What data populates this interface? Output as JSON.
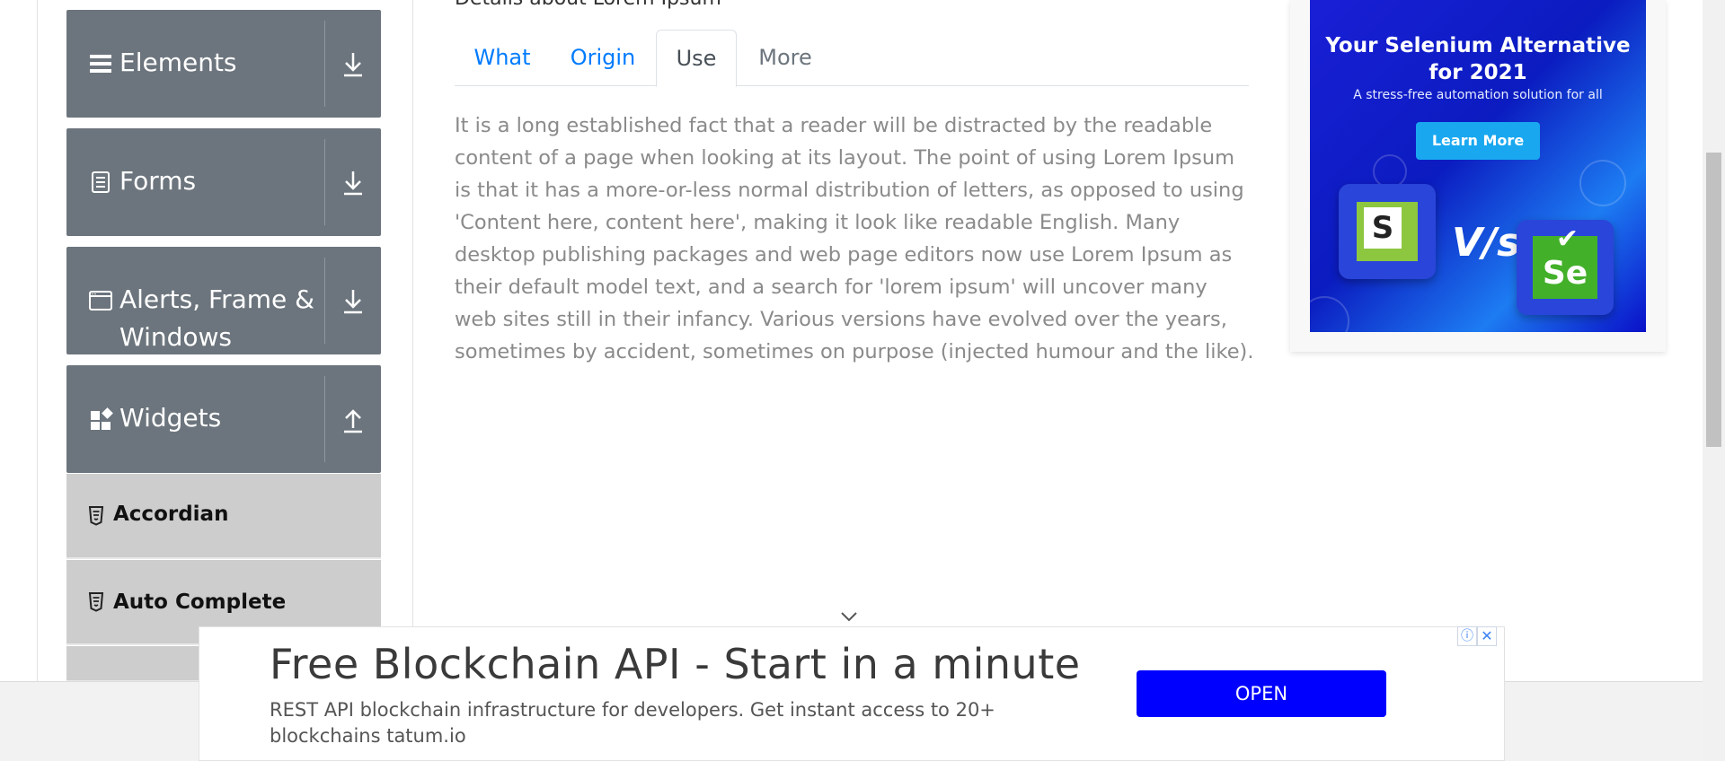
{
  "sidebar": {
    "groups": [
      {
        "label": "Elements",
        "icon": "hamburger-icon",
        "arrow": "download-arrow-icon"
      },
      {
        "label": "Forms",
        "icon": "document-icon",
        "arrow": "download-arrow-icon"
      },
      {
        "label_line1": "Alerts, Frame &",
        "label_line2": "Windows",
        "icon": "window-icon",
        "arrow": "download-arrow-icon"
      },
      {
        "label": "Widgets",
        "icon": "widgets-icon",
        "arrow": "upload-arrow-icon"
      }
    ],
    "items": [
      {
        "label": "Accordian",
        "icon": "html5-icon"
      },
      {
        "label": "Auto Complete",
        "icon": "html5-icon"
      }
    ]
  },
  "main": {
    "caption": "Details about Lorem Ipsum",
    "tabs": [
      {
        "label": "What",
        "state": "link"
      },
      {
        "label": "Origin",
        "state": "link"
      },
      {
        "label": "Use",
        "state": "active"
      },
      {
        "label": "More",
        "state": "disabled"
      }
    ],
    "content": "It is a long established fact that a reader will be distracted by the readable content of a page when looking at its layout. The point of using Lorem Ipsum is that it has a more-or-less normal distribution of letters, as opposed to using 'Content here, content here', making it look like readable English. Many desktop publishing packages and web page editors now use Lorem Ipsum as their default model text, and a search for 'lorem ipsum' will uncover many web sites still in their infancy. Various versions have evolved over the years, sometimes by accident, sometimes on purpose (injected humour and the like)."
  },
  "ad_right": {
    "title_line1": "Your Selenium Alternative",
    "title_line2": "for 2021",
    "subtitle": "A stress-free automation solution for all",
    "button": "Learn More",
    "logo_left_letter": "S",
    "vs_text": "V/s",
    "logo_right_text": "Se"
  },
  "ad_bottom": {
    "headline": "Free Blockchain API - Start in a minute",
    "description": "REST API blockchain infrastructure for developers. Get instant access to 20+ blockchains tatum.io",
    "button": "OPEN",
    "info_symbol": "ⓘ",
    "close_symbol": "✕"
  },
  "colors": {
    "sidebar_group_bg": "#6c757d",
    "sidebar_item_bg": "#cdcdcd",
    "tab_link": "#007bff",
    "ad_button": "#0000ff"
  }
}
